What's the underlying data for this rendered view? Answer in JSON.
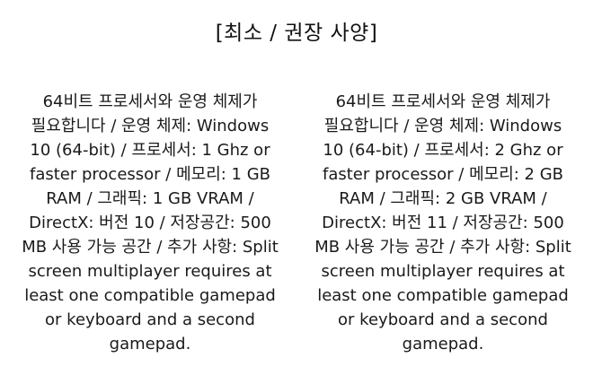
{
  "heading": "[최소 / 권장 사양]",
  "minimum": {
    "text": "64비트 프로세서와 운영 체제가 필요합니다 / 운영 체제: Windows 10 (64-bit) / 프로세서: 1 Ghz or faster processor / 메모리: 1 GB RAM / 그래픽: 1 GB VRAM / DirectX: 버전 10 / 저장공간: 500 MB 사용 가능 공간 / 추가 사항: Split screen multiplayer requires at least one compatible gamepad or keyboard and a second gamepad."
  },
  "recommended": {
    "text": "64비트 프로세서와 운영 체제가 필요합니다 / 운영 체제: Windows 10 (64-bit) / 프로세서: 2 Ghz or faster processor / 메모리: 2 GB RAM / 그래픽: 2 GB VRAM / DirectX: 버전 11 / 저장공간: 500 MB 사용 가능 공간 / 추가 사항: Split screen multiplayer requires at least one compatible gamepad or keyboard and a second gamepad."
  }
}
